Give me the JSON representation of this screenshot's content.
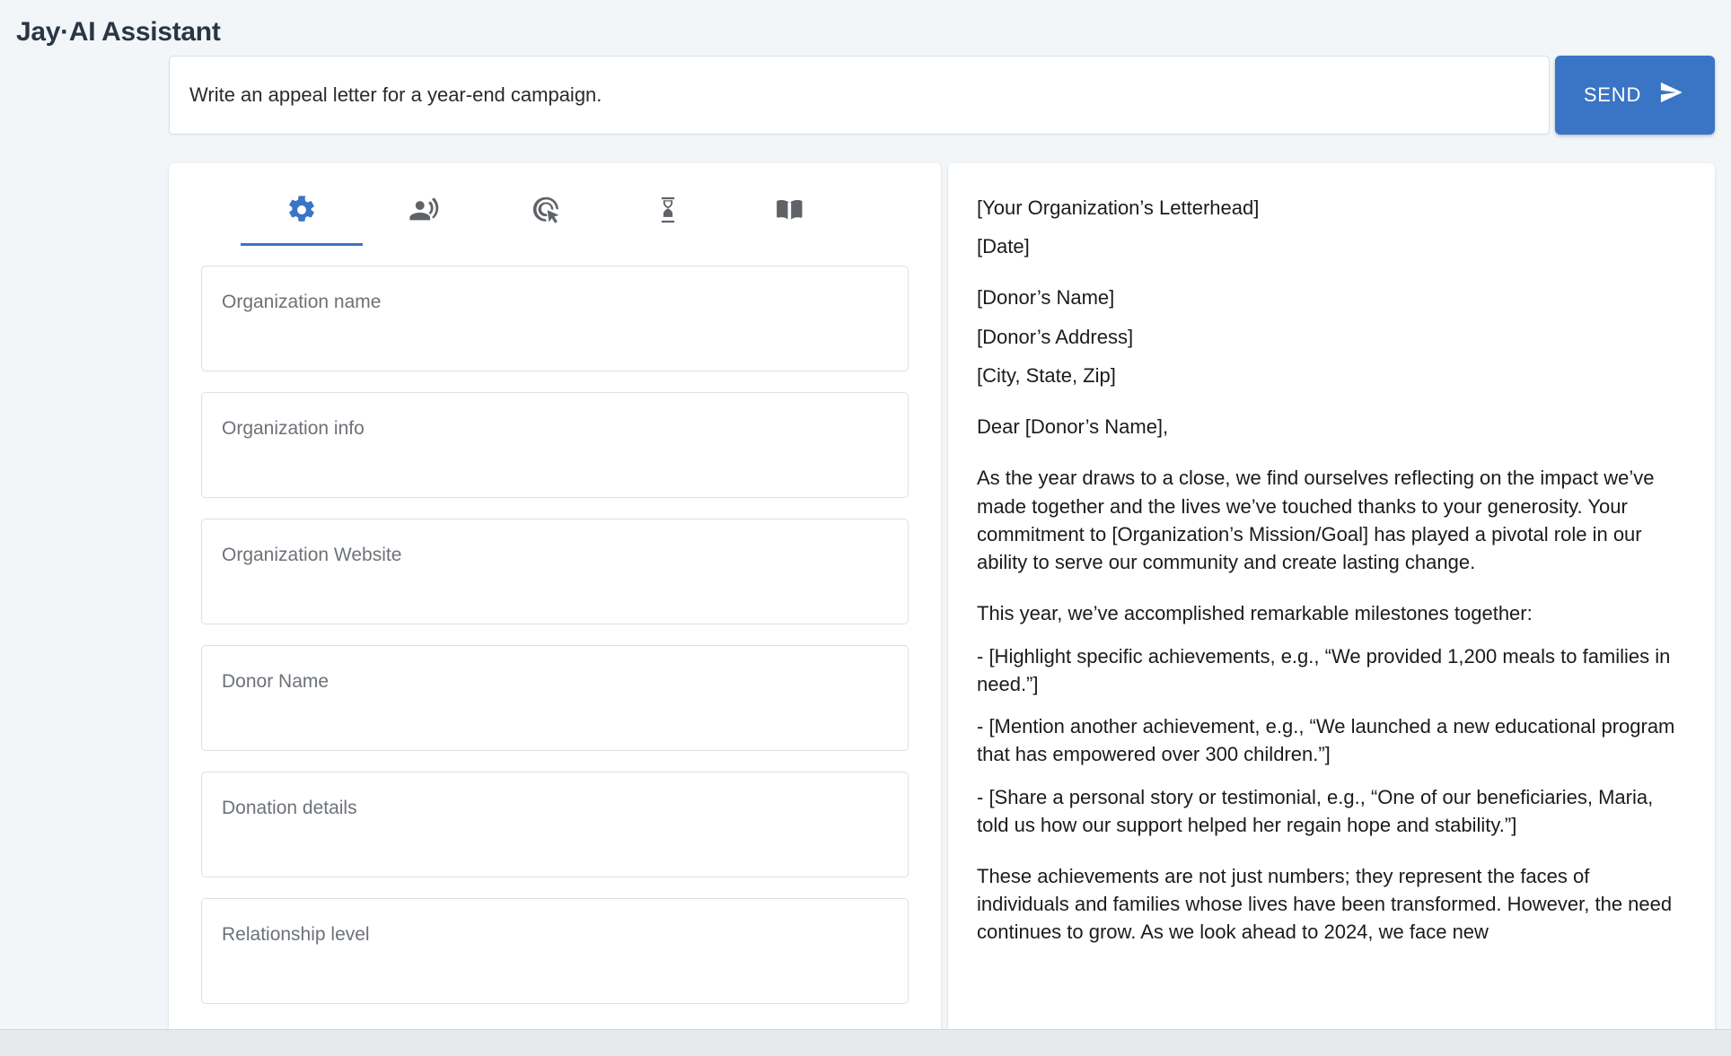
{
  "header": {
    "title": "Jay·AI Assistant"
  },
  "prompt": {
    "value": "Write an appeal letter for a year-end campaign.",
    "placeholder": "Write an appeal letter for a year-end campaign.",
    "send_label": "SEND",
    "send_icon": "send-icon",
    "accent_color": "#3a74c4"
  },
  "tabs": [
    {
      "id": "settings",
      "icon": "gear-icon",
      "active": true
    },
    {
      "id": "voice",
      "icon": "record-voice-icon",
      "active": false
    },
    {
      "id": "ads",
      "icon": "ad-target-icon",
      "active": false
    },
    {
      "id": "history",
      "icon": "hourglass-icon",
      "active": false
    },
    {
      "id": "library",
      "icon": "open-book-icon",
      "active": false
    }
  ],
  "form": {
    "fields": [
      {
        "name": "organization-name",
        "placeholder": "Organization name",
        "value": ""
      },
      {
        "name": "organization-info",
        "placeholder": "Organization info",
        "value": ""
      },
      {
        "name": "organization-website",
        "placeholder": "Organization Website",
        "value": ""
      },
      {
        "name": "donor-name",
        "placeholder": "Donor Name",
        "value": ""
      },
      {
        "name": "donation-details",
        "placeholder": "Donation details",
        "value": ""
      },
      {
        "name": "relationship-level",
        "placeholder": "Relationship level",
        "value": ""
      }
    ]
  },
  "letter": {
    "letterhead": "[Your Organization’s Letterhead]",
    "date": "[Date]",
    "donor_name": "[Donor’s Name]",
    "donor_address": "[Donor’s Address]",
    "donor_city_state_zip": "[City, State, Zip]",
    "salutation": "Dear [Donor’s Name],",
    "paragraph_1": "As the year draws to a close, we find ourselves reflecting on the impact we’ve made together and the lives we’ve touched thanks to your generosity. Your commitment to [Organization’s Mission/Goal] has played a pivotal role in our ability to serve our community and create lasting change.",
    "milestones_intro": "This year, we’ve accomplished remarkable milestones together:",
    "bullet_1": "- [Highlight specific achievements, e.g., “We provided 1,200 meals to families in need.”]",
    "bullet_2": "- [Mention another achievement, e.g., “We launched a new educational program that has empowered over 300 children.”]",
    "bullet_3": "- [Share a personal story or testimonial, e.g., “One of our beneficiaries, Maria, told us how our support helped her regain hope and stability.”]",
    "paragraph_2": "These achievements are not just numbers; they represent the faces of individuals and families whose lives have been transformed. However, the need continues to grow. As we look ahead to 2024, we face new"
  }
}
